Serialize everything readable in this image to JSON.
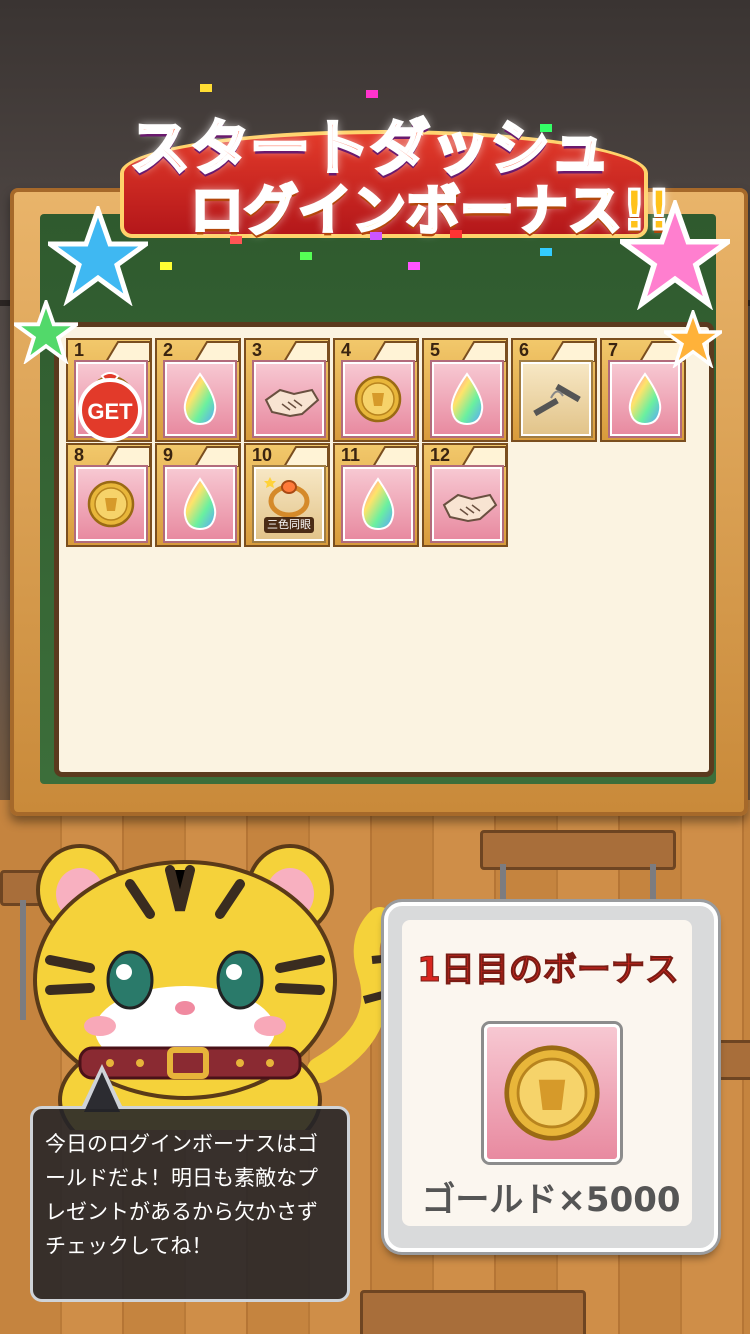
{
  "title": {
    "line1": "スタートダッシュ",
    "line2": "ログインボーナス!!"
  },
  "grid": {
    "days": [
      {
        "day": "1",
        "item": "gold-coin-icon",
        "get": true,
        "bg": "pink"
      },
      {
        "day": "2",
        "item": "rainbow-gem-icon",
        "bg": "pink"
      },
      {
        "day": "3",
        "item": "handshake-icon",
        "bg": "pink"
      },
      {
        "day": "4",
        "item": "gold-coin-icon",
        "bg": "pink"
      },
      {
        "day": "5",
        "item": "rainbow-gem-icon",
        "bg": "pink"
      },
      {
        "day": "6",
        "item": "nunchaku-icon",
        "bg": "beige"
      },
      {
        "day": "7",
        "item": "rainbow-gem-icon",
        "bg": "pink"
      },
      {
        "day": "8",
        "item": "gold-coin-icon",
        "bg": "pink"
      },
      {
        "day": "9",
        "item": "rainbow-gem-icon",
        "bg": "pink"
      },
      {
        "day": "10",
        "item": "ring-icon",
        "bg": "beige",
        "label": "三色同眼"
      },
      {
        "day": "11",
        "item": "rainbow-gem-icon",
        "bg": "pink"
      },
      {
        "day": "12",
        "item": "handshake-icon",
        "bg": "pink"
      }
    ],
    "get_label": "GET"
  },
  "bonus": {
    "title": "1日目のボーナス",
    "item_icon": "gold-coin-icon",
    "amount": "ゴールド×5000"
  },
  "dialog": {
    "text": "今日のログインボーナスはゴールドだよ！明日も素敵なプレゼントがあるから欠かさずチェックしてね！"
  },
  "colors": {
    "accent_red": "#d7261f",
    "cell_pink": "#e88aa0",
    "frame_wood": "#c98a3a",
    "chalkboard": "#3c6e3a"
  }
}
